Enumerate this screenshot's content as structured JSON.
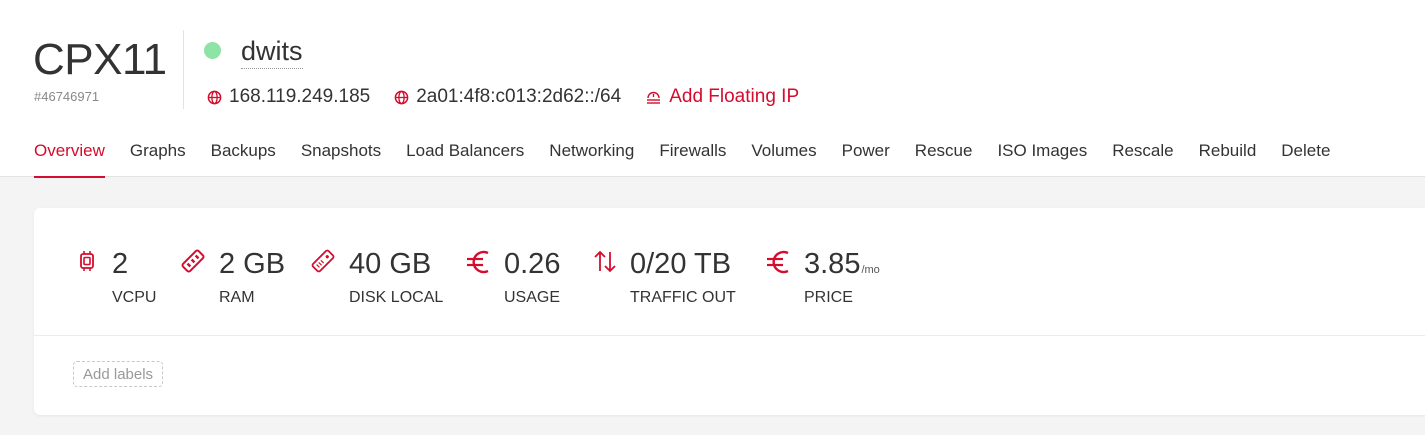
{
  "server": {
    "type": "CPX11",
    "id": "#46746971",
    "name": "dwits",
    "status_color": "#8de4a6"
  },
  "ips": {
    "ipv4": "168.119.249.185",
    "ipv6": "2a01:4f8:c013:2d62::/64",
    "add_floating": "Add Floating IP"
  },
  "tabs": [
    {
      "label": "Overview",
      "active": true
    },
    {
      "label": "Graphs"
    },
    {
      "label": "Backups"
    },
    {
      "label": "Snapshots"
    },
    {
      "label": "Load Balancers"
    },
    {
      "label": "Networking"
    },
    {
      "label": "Firewalls"
    },
    {
      "label": "Volumes"
    },
    {
      "label": "Power"
    },
    {
      "label": "Rescue"
    },
    {
      "label": "ISO Images"
    },
    {
      "label": "Rescale"
    },
    {
      "label": "Rebuild"
    },
    {
      "label": "Delete"
    }
  ],
  "metrics": {
    "vcpu": {
      "value": "2",
      "label": "VCPU",
      "icon": "cpu-icon"
    },
    "ram": {
      "value": "2 GB",
      "label": "RAM",
      "icon": "ram-icon"
    },
    "disk": {
      "value": "40 GB",
      "label": "DISK LOCAL",
      "icon": "disk-icon"
    },
    "usage": {
      "value": "0.26",
      "label": "USAGE",
      "icon": "euro-icon"
    },
    "traffic": {
      "value": "0/20 TB",
      "label": "TRAFFIC OUT",
      "icon": "traffic-icon"
    },
    "price": {
      "value": "3.85",
      "unit": "/mo",
      "label": "PRICE",
      "icon": "euro-icon"
    }
  },
  "labels": {
    "add": "Add labels"
  },
  "colors": {
    "accent": "#d50c2d",
    "status_online": "#8de4a6"
  }
}
